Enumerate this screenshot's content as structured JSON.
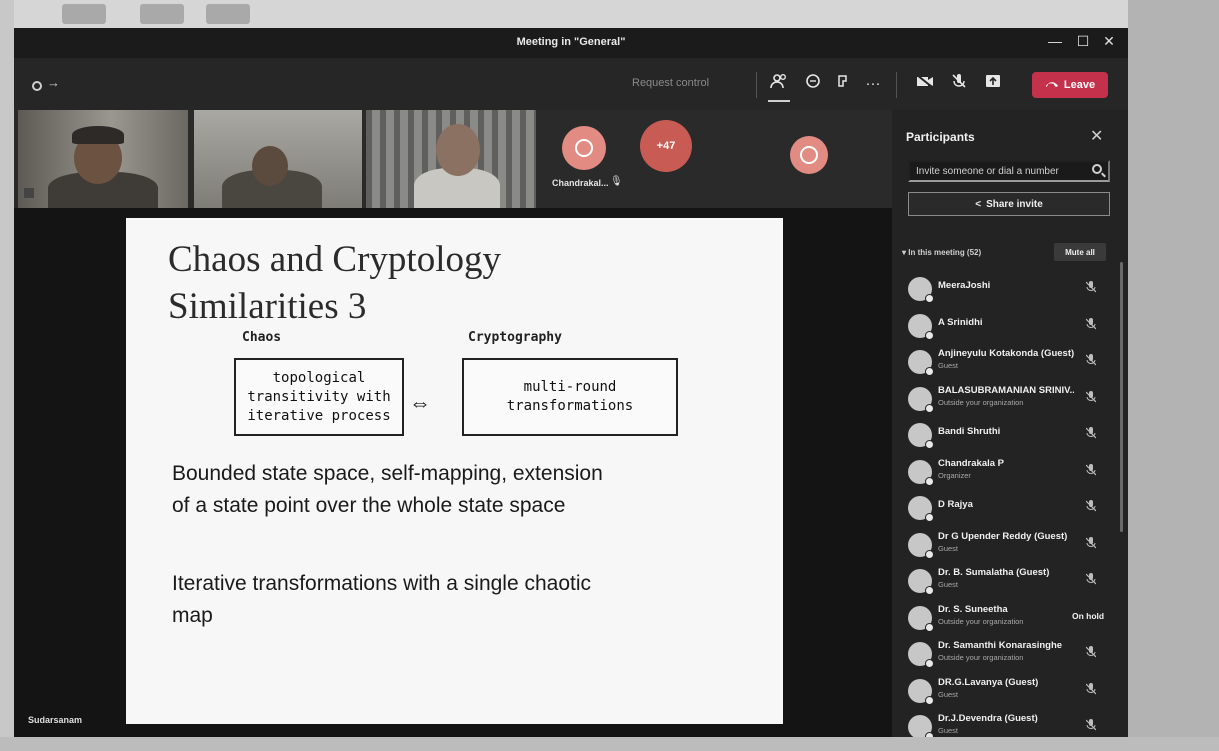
{
  "window": {
    "title": "Meeting in \"General\"",
    "controls": {
      "minimize": "—",
      "maximize": "☐",
      "close": "✕"
    }
  },
  "toolbar": {
    "request_control": "Request control",
    "icons": [
      "participants-icon",
      "chat-icon",
      "reactions-icon",
      "more-icon",
      "camera-off-icon",
      "mic-off-icon",
      "share-icon"
    ],
    "leave_label": "Leave",
    "leave_color": "#c4314b"
  },
  "video_strip": {
    "avatar_name": "Chandrakal...",
    "more_count": "+47",
    "avatar_color": "#e28b83"
  },
  "stage": {
    "presenter_name": "Sudarsanam"
  },
  "slide": {
    "title_line1": "Chaos and Cryptology",
    "title_line2": "Similarities 3",
    "left_label": "Chaos",
    "right_label": "Cryptography",
    "left_box_line1": "topological",
    "left_box_line2": "transitivity with",
    "left_box_line3": "iterative process",
    "right_box_line1": "multi-round",
    "right_box_line2": "transformations",
    "arrow": "⇔",
    "bullet1_line1": "Bounded state space, self-mapping, extension",
    "bullet1_line2": "of a state point over the whole state space",
    "bullet2_line1": "Iterative transformations with a single chaotic",
    "bullet2_line2": "map"
  },
  "participants": {
    "title": "Participants",
    "invite_placeholder": "Invite someone or dial a number",
    "share_invite": "Share invite",
    "in_meeting": "In this meeting (52)",
    "mute_all": "Mute all",
    "list": [
      {
        "name": "MeeraJoshi",
        "sub": "",
        "status": "mic-off"
      },
      {
        "name": "A Srinidhi",
        "sub": "",
        "status": "mic-off"
      },
      {
        "name": "Anjineyulu Kotakonda (Guest)",
        "sub": "Guest",
        "status": "mic-off"
      },
      {
        "name": "BALASUBRAMANIAN SRINIV...",
        "sub": "Outside your organization",
        "status": "mic-off"
      },
      {
        "name": "Bandi Shruthi",
        "sub": "",
        "status": "mic-off"
      },
      {
        "name": "Chandrakala P",
        "sub": "Organizer",
        "status": "mic-off"
      },
      {
        "name": "D Rajya",
        "sub": "",
        "status": "mic-off"
      },
      {
        "name": "Dr G Upender Reddy (Guest)",
        "sub": "Guest",
        "status": "mic-off"
      },
      {
        "name": "Dr. B. Sumalatha (Guest)",
        "sub": "Guest",
        "status": "mic-off"
      },
      {
        "name": "Dr. S. Suneetha",
        "sub": "Outside your organization",
        "status": "On hold"
      },
      {
        "name": "Dr. Samanthi Konarasinghe",
        "sub": "Outside your organization",
        "status": "mic-off"
      },
      {
        "name": "DR.G.Lavanya (Guest)",
        "sub": "Guest",
        "status": "mic-off"
      },
      {
        "name": "Dr.J.Devendra (Guest)",
        "sub": "Guest",
        "status": "mic-off"
      }
    ]
  }
}
